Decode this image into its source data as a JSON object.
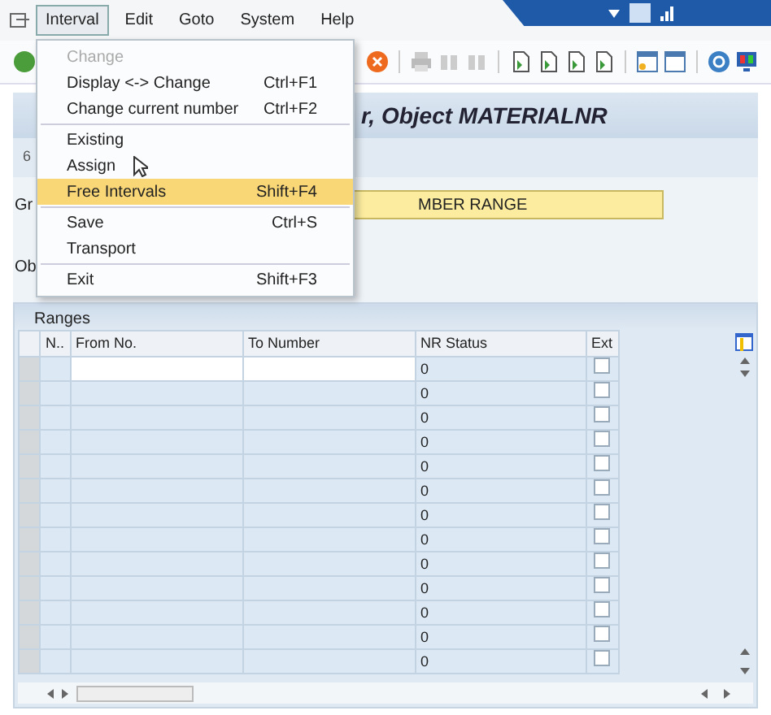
{
  "menu_bar": {
    "items": [
      {
        "label": "Interval",
        "selected": true
      },
      {
        "label": "Edit",
        "selected": false
      },
      {
        "label": "Goto",
        "selected": false
      },
      {
        "label": "System",
        "selected": false
      },
      {
        "label": "Help",
        "selected": false
      }
    ]
  },
  "interval_menu": {
    "sections": [
      [
        {
          "label": "Change",
          "disabled": true,
          "selected": false
        },
        {
          "label": "Display <-> Change",
          "shortcut": "Ctrl+F1",
          "disabled": false,
          "selected": false
        },
        {
          "label": "Change current number",
          "shortcut": "Ctrl+F2",
          "disabled": false,
          "selected": false
        }
      ],
      [
        {
          "label": "Existing",
          "disabled": false,
          "selected": false
        },
        {
          "label": "Assign",
          "disabled": false,
          "selected": false
        },
        {
          "label": "Free Intervals",
          "shortcut": "Shift+F4",
          "disabled": false,
          "selected": true
        }
      ],
      [
        {
          "label": "Save",
          "shortcut": "Ctrl+S",
          "disabled": false,
          "selected": false
        },
        {
          "label": "Transport",
          "disabled": false,
          "selected": false
        }
      ],
      [
        {
          "label": "Exit",
          "shortcut": "Shift+F3",
          "disabled": false,
          "selected": false
        }
      ]
    ]
  },
  "title": "r, Object MATERIALNR",
  "subheader_text": "6",
  "group_label": "Gr",
  "group_field": {
    "value": "MBER RANGE"
  },
  "object_label": "Ob",
  "ranges": {
    "title": "Ranges",
    "columns": [
      "N..",
      "From No.",
      "To Number",
      "NR Status",
      "Ext"
    ],
    "rows": [
      {
        "nr_status": "0",
        "ext": false,
        "selected": true
      },
      {
        "nr_status": "0",
        "ext": false,
        "selected": false
      },
      {
        "nr_status": "0",
        "ext": false,
        "selected": false
      },
      {
        "nr_status": "0",
        "ext": false,
        "selected": false
      },
      {
        "nr_status": "0",
        "ext": false,
        "selected": false
      },
      {
        "nr_status": "0",
        "ext": false,
        "selected": false
      },
      {
        "nr_status": "0",
        "ext": false,
        "selected": false
      },
      {
        "nr_status": "0",
        "ext": false,
        "selected": false
      },
      {
        "nr_status": "0",
        "ext": false,
        "selected": false
      },
      {
        "nr_status": "0",
        "ext": false,
        "selected": false
      },
      {
        "nr_status": "0",
        "ext": false,
        "selected": false
      },
      {
        "nr_status": "0",
        "ext": false,
        "selected": false
      },
      {
        "nr_status": "0",
        "ext": false,
        "selected": false
      }
    ]
  }
}
